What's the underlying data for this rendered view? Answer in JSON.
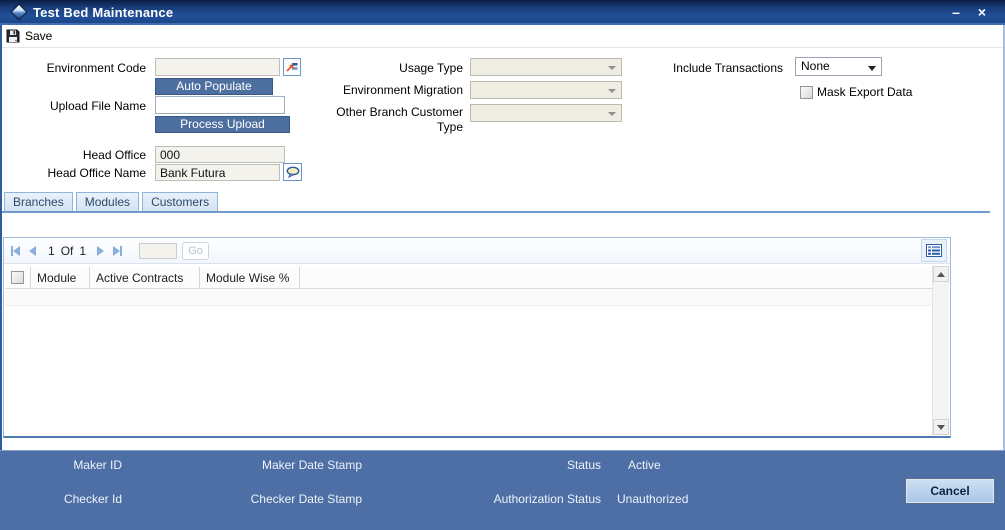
{
  "window": {
    "title": "Test Bed Maintenance",
    "minimize": "–",
    "close": "×"
  },
  "toolbar": {
    "save": "Save"
  },
  "form": {
    "environment_code": {
      "label": "Environment Code",
      "value": ""
    },
    "auto_populate": "Auto Populate",
    "upload_file_name": {
      "label": "Upload File Name",
      "value": ""
    },
    "process_upload": "Process Upload",
    "head_office": {
      "label": "Head Office",
      "value": "000"
    },
    "head_office_name": {
      "label": "Head Office Name",
      "value": "Bank Futura"
    },
    "usage_type": {
      "label": "Usage Type",
      "value": ""
    },
    "environment_migration": {
      "label": "Environment Migration",
      "value": ""
    },
    "other_branch_customer_type": {
      "label": "Other Branch Customer Type",
      "value": ""
    },
    "include_transactions": {
      "label": "Include Transactions",
      "value": "None"
    },
    "mask_export_data": {
      "label": "Mask Export Data",
      "checked": false
    }
  },
  "tabs": [
    {
      "label": "Branches"
    },
    {
      "label": "Modules"
    },
    {
      "label": "Customers"
    }
  ],
  "pagination": {
    "page": "1",
    "of": "Of",
    "total": "1",
    "goto_value": "",
    "go": "Go"
  },
  "table": {
    "select_all_checked": false,
    "columns": [
      "Module",
      "Active Contracts",
      "Module Wise %"
    ],
    "rows": []
  },
  "footer": {
    "maker_id_label": "Maker ID",
    "maker_date_stamp_label": "Maker Date Stamp",
    "checker_id_label": "Checker Id",
    "checker_date_stamp_label": "Checker Date Stamp",
    "status_label": "Status",
    "status_value": "Active",
    "authorization_status_label": "Authorization Status",
    "authorization_status_value": "Unauthorized",
    "cancel": "Cancel"
  },
  "icons": {
    "title": "diamond-icon",
    "save": "floppy-disk-icon",
    "environment_code_lookup": "lov-icon",
    "head_office_name_language": "language-bubble-icon",
    "pagination_first": "first-page-icon",
    "pagination_prev": "prev-page-icon",
    "pagination_next": "next-page-icon",
    "pagination_last": "last-page-icon",
    "grid_settings": "column-settings-icon",
    "scroll_up": "scroll-up-icon",
    "scroll_down": "scroll-down-icon"
  },
  "colors": {
    "titlebar_blue": "#1f4c93",
    "footer_blue": "#4e6fa5",
    "button_slate": "#4d6f9f",
    "tab_fill": "#d2e2f2",
    "accent_border": "#6f9bcd",
    "disabled_field": "#f3f2ec"
  }
}
